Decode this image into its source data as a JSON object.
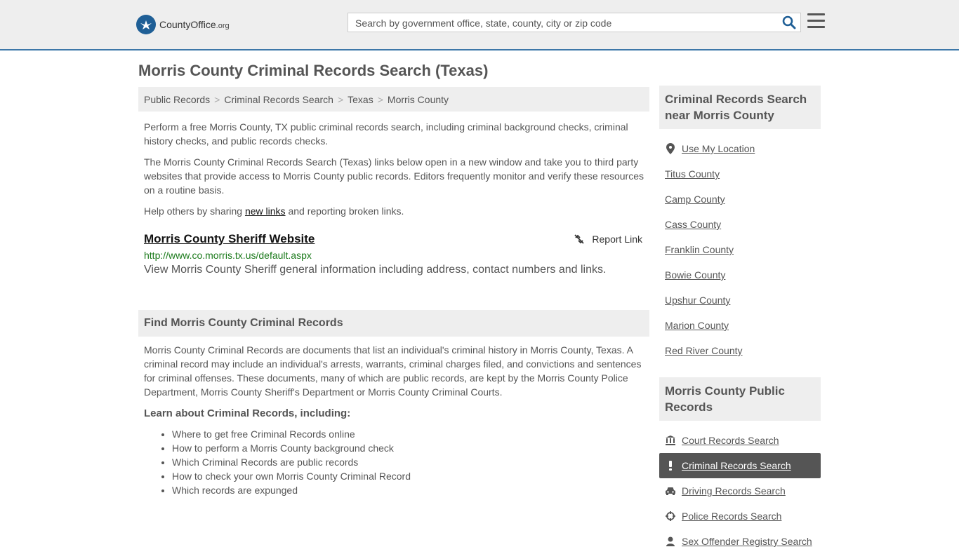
{
  "header": {
    "logo_county": "County",
    "logo_office": "Office",
    "logo_tld": ".org",
    "search_placeholder": "Search by government office, state, county, city or zip code"
  },
  "page_title": "Morris County Criminal Records Search (Texas)",
  "breadcrumb": [
    "Public Records",
    "Criminal Records Search",
    "Texas",
    "Morris County"
  ],
  "intro": {
    "p1": "Perform a free Morris County, TX public criminal records search, including criminal background checks, criminal history checks, and public records checks.",
    "p2": "The Morris County Criminal Records Search (Texas) links below open in a new window and take you to third party websites that provide access to Morris County public records. Editors frequently monitor and verify these resources on a routine basis.",
    "p3_before": "Help others by sharing ",
    "p3_link": "new links",
    "p3_after": " and reporting broken links."
  },
  "result": {
    "title": "Morris County Sheriff Website",
    "report_label": "Report Link",
    "url": "http://www.co.morris.tx.us/default.aspx",
    "description": "View Morris County Sheriff general information including address, contact numbers and links."
  },
  "find_section": {
    "heading": "Find Morris County Criminal Records",
    "body": "Morris County Criminal Records are documents that list an individual's criminal history in Morris County, Texas. A criminal record may include an individual's arrests, warrants, criminal charges filed, and convictions and sentences for criminal offenses. These documents, many of which are public records, are kept by the Morris County Police Department, Morris County Sheriff's Department or Morris County Criminal Courts.",
    "learn_heading": "Learn about Criminal Records, including:",
    "learn_items": [
      "Where to get free Criminal Records online",
      "How to perform a Morris County background check",
      "Which Criminal Records are public records",
      "How to check your own Morris County Criminal Record",
      "Which records are expunged"
    ]
  },
  "sidebar": {
    "nearby_heading": "Criminal Records Search near Morris County",
    "use_location": "Use My Location",
    "nearby": [
      "Titus County",
      "Camp County",
      "Cass County",
      "Franklin County",
      "Bowie County",
      "Upshur County",
      "Marion County",
      "Red River County"
    ],
    "public_heading": "Morris County Public Records",
    "public_links": [
      {
        "label": "Court Records Search",
        "icon": "courthouse-icon"
      },
      {
        "label": "Criminal Records Search",
        "icon": "exclamation-icon",
        "active": true
      },
      {
        "label": "Driving Records Search",
        "icon": "car-icon"
      },
      {
        "label": "Police Records Search",
        "icon": "crosshair-icon"
      },
      {
        "label": "Sex Offender Registry Search",
        "icon": "user-icon"
      }
    ]
  },
  "colors": {
    "header_bg": "#eeeeee",
    "header_border": "#3d77a8",
    "active_item_bg": "#555555",
    "url_green": "#1b7a1b",
    "logo_blue": "#1f5f96"
  }
}
